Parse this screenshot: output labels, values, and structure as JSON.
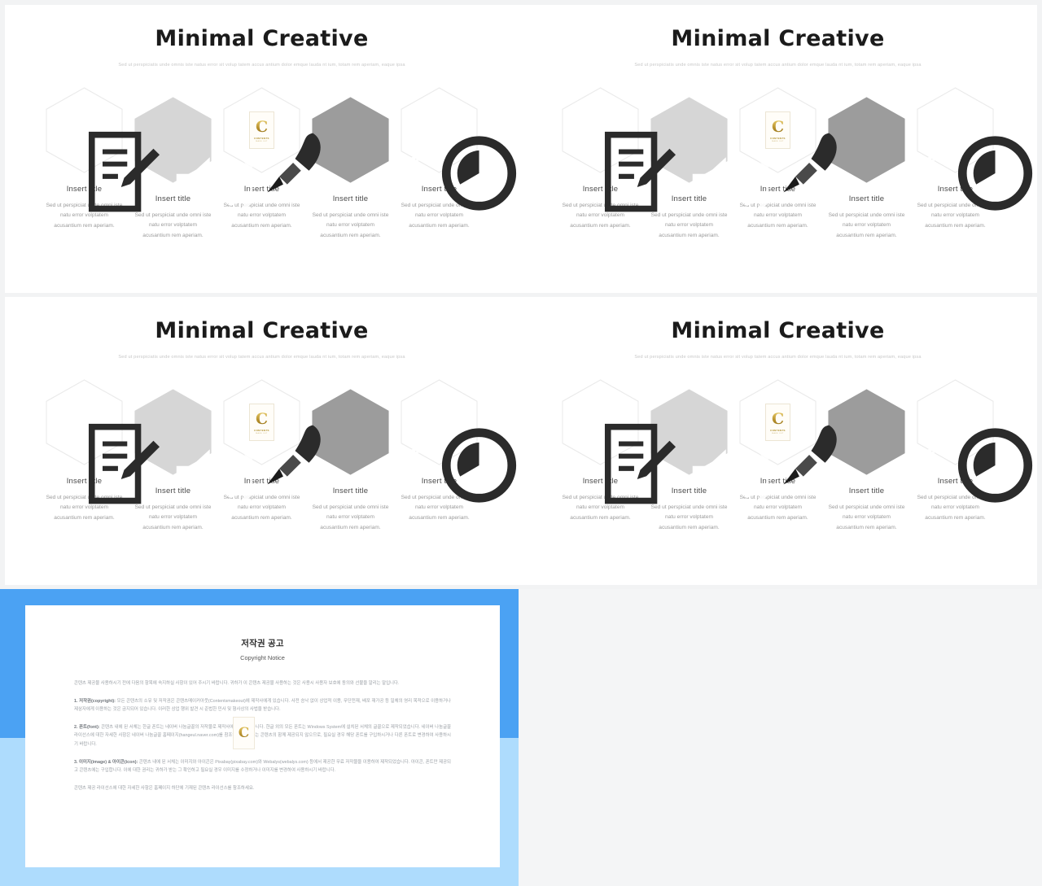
{
  "deck": {
    "title": "Minimal Creative",
    "subtitle": "Sed ut perspiciatis unde omnis iste natus error sit volup tatem accus antium dolor emque lauda nt ium, totam rem aperiam, eaque ipsa"
  },
  "items": [
    {
      "icon": "note-edit-icon",
      "title": "Insert title",
      "desc": "Sed ut perspiciat unde omni iste natu error volptatem acusantium rem aperiam.",
      "fill": "#ffffff",
      "stroke": "#eaeaea",
      "glyph_color": "#2b2b2b"
    },
    {
      "icon": "speaker-volume-icon",
      "title": "Insert title",
      "desc": "Sed ut perspiciat unde omni iste natu error volptatem acusantium rem aperiam.",
      "fill": "#d6d6d6",
      "stroke": "#d6d6d6",
      "glyph_color": "#ffffff"
    },
    {
      "icon": "brand-logo-icon",
      "title": "Insert title",
      "desc": "Sed ut perspiciat unde omni iste natu error volptatem acusantium rem aperiam.",
      "fill": "#ffffff",
      "stroke": "#eaeaea",
      "glyph_color": "#b7902c"
    },
    {
      "icon": "paper-plane-send-icon",
      "title": "Insert title",
      "desc": "Sed ut perspiciat unde omni iste natu error volptatem acusantium rem aperiam.",
      "fill": "#9c9c9c",
      "stroke": "#9c9c9c",
      "glyph_color": "#ffffff"
    },
    {
      "icon": "clock-circle-icon",
      "title": "Insert title",
      "desc": "Sed ut perspiciat unde omni iste natu error volptatem acusantium rem aperiam.",
      "fill": "#ffffff",
      "stroke": "#eaeaea",
      "glyph_color": "#2b2b2b"
    }
  ],
  "logo": {
    "letter": "C",
    "word": "CONTENTS",
    "word2": "MAKE  OUT"
  },
  "copyright": {
    "title": "저작권 공고",
    "subtitle": "Copyright Notice",
    "intro": "콘텐츠 제공물 사용하시기 전에 다음의 항목에 숙지하실 사항이 있어 주시기 바랍니다. 귀하가 이 콘텐츠 제공물 사용하는 것은 사용시 사용자 보호에 동의와 선불을 알리는 말입니다.",
    "sections": [
      {
        "label": "1. 저작권(copyright):",
        "text": " 모든 콘텐츠의 소유 및 저작권은 콘텐츠메이커아웃(Contentsmakeout)에 제작사에게 있습니다. 사전 승낙 없이 상업적 이용, 무단전재, 배포 재가공 등 일체의 영리 목적으로 이용하거나 제삼자에게 이용하는 것은 금지되어 있습니다. 이러한 상업 행위 발견 시 준법한 민사 및 형사상의 사법을 받습니다."
      },
      {
        "label": "2. 폰트(font):",
        "text": " 콘텐츠 내에 된 서체는 한글 폰트는 네이버 나눔글꼴의 저작물로 제작사에 제작되었습니다. 한글 외의 모든 폰트는 Windows System에 설치된 서체의 글꼴으로 제작되었습니다. 네이버 나눔글꼴 라이선스에 대한 자세한 사항은 네이버 나눔글꼴 홈페이지(hangeul.naver.com)를 참조하세요. 폰트는 콘텐츠의 함께 제공되지 않으므로, 필요실 경우 해당 폰트를 구입하시거나 다른 폰트로 변경하여 사용하시기 바랍니다."
      },
      {
        "label": "3. 이미지(image) & 아이콘(icon):",
        "text": " 콘텐츠 내에 된 서체는 이미지와 아이콘은 Pixabay(pixabay.com)와 Webalys(webalys.com) 등에서 제공한 무료 저작물을 이용하여 제작되었습니다. 아이콘, 폰트만 제공되고 콘텐츠에는 구입합니다. 이에 대한 권리는 귀하가 받는 그 확인하고 필요실 경우 이미지를 수정하거나 이미지를 변경하여 사용하시기 바랍니다."
      }
    ],
    "footer": "콘텐츠 제공 라이선스에 대한 자세한 사항은 홈페이지 하단에 기재된 콘텐츠 라이선스를 참조하세요."
  },
  "colors": {
    "canvas": "#f2f3f4",
    "slide_bg": "#ffffff",
    "hex_light_gray": "#d6d6d6",
    "hex_dark_gray": "#9c9c9c",
    "hex_outline": "#eaeaea",
    "blue_strong": "#4ba2f3",
    "blue_light": "#aedcfd",
    "gold": "#b7902c"
  }
}
